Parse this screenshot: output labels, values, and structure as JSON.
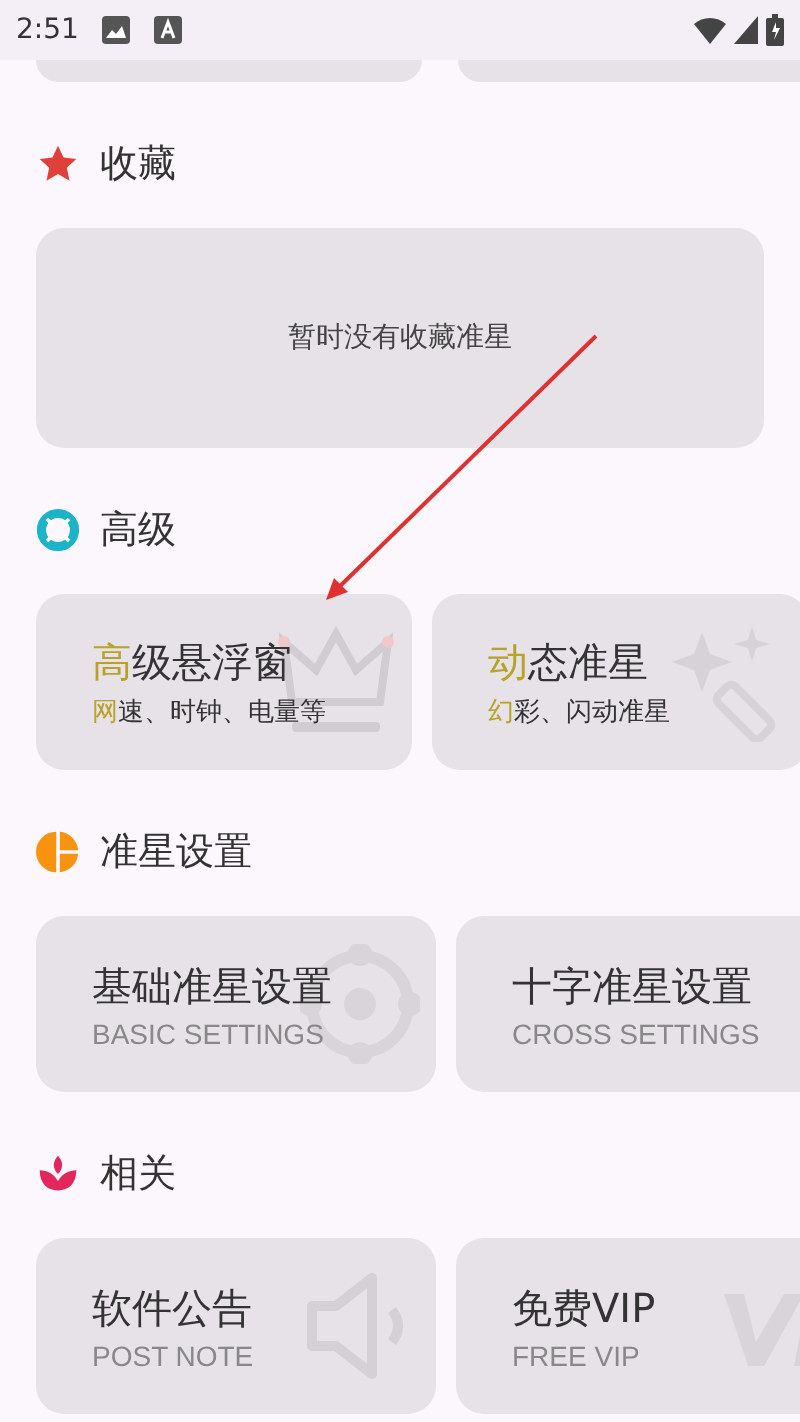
{
  "status_bar": {
    "time": "2:51"
  },
  "sections": [
    {
      "title": "收藏",
      "kind": "empty",
      "empty_text": "暂时没有收藏准星"
    },
    {
      "title": "高级",
      "kind": "feature",
      "cards": [
        {
          "title": "高级悬浮窗",
          "subtitle": "网速、时钟、电量等"
        },
        {
          "title": "动态准星",
          "subtitle": "幻彩、闪动准星"
        }
      ]
    },
    {
      "title": "准星设置",
      "kind": "setting",
      "cards": [
        {
          "title": "基础准星设置",
          "subtitle": "BASIC SETTINGS"
        },
        {
          "title": "十字准星设置",
          "subtitle": "CROSS SETTINGS"
        }
      ]
    },
    {
      "title": "相关",
      "kind": "setting",
      "cards": [
        {
          "title": "软件公告",
          "subtitle": "POST NOTE"
        },
        {
          "title": "免费VIP",
          "subtitle": "FREE VIP"
        }
      ]
    }
  ]
}
